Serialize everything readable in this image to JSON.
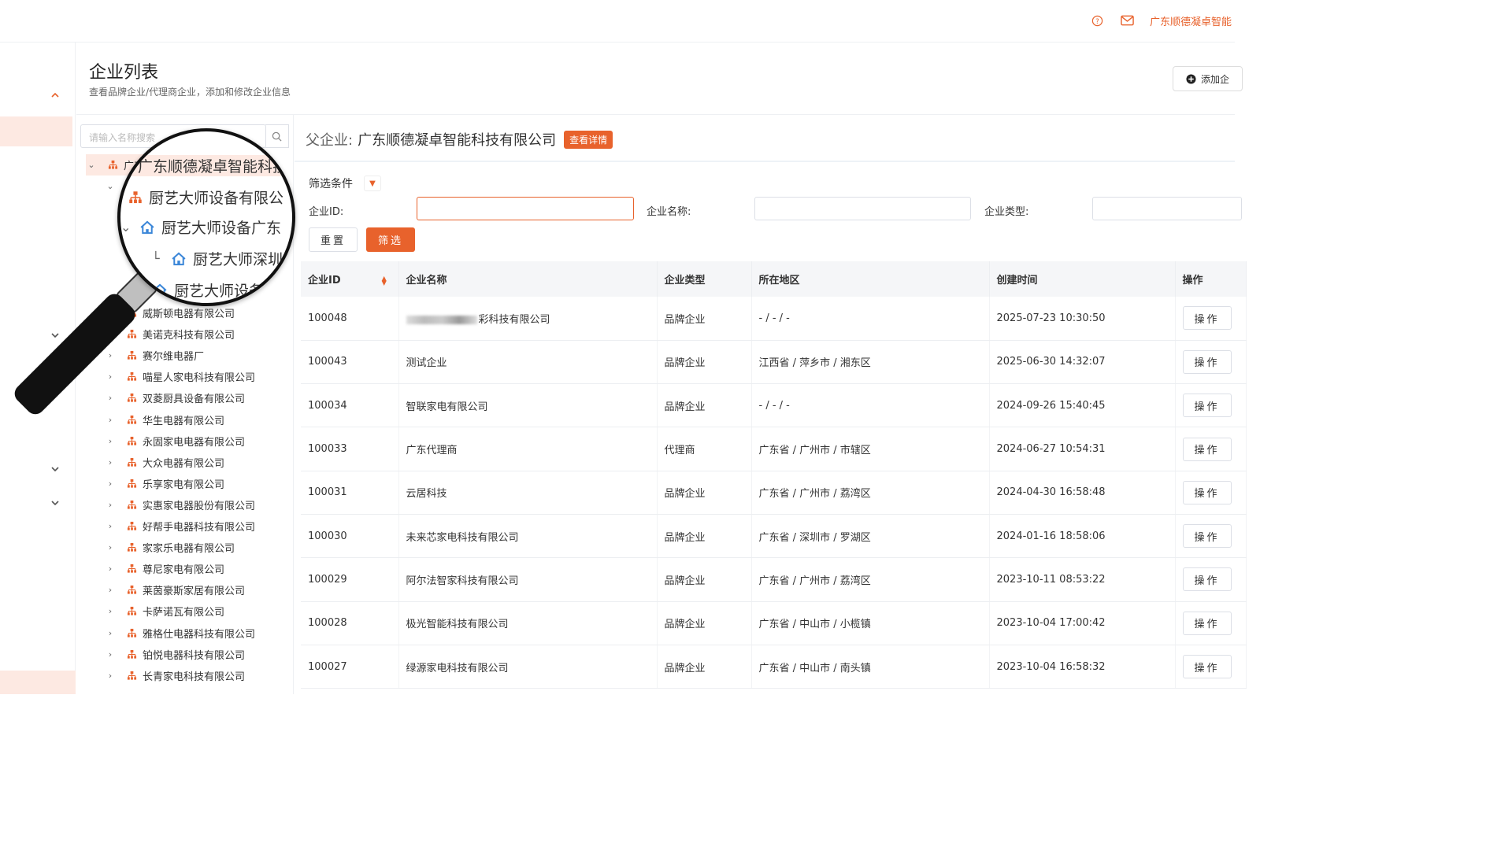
{
  "topbar": {
    "help_icon": "help-circle-icon",
    "mail_icon": "mail-icon",
    "company": "广东顺德凝卓智能"
  },
  "header": {
    "title": "企业列表",
    "subtitle": "查看品牌企业/代理商企业，添加和修改企业信息",
    "add_button": "添加企"
  },
  "sidebar": {
    "search_placeholder": "请输入名称搜索",
    "tree": [
      {
        "label": "广东顺德凝卓智能科技",
        "level": 0,
        "icon": "org-icon",
        "expanded": true
      },
      {
        "label": "厨艺大师设备有限公",
        "level": 1,
        "icon": "org-icon",
        "expanded": true
      },
      {
        "label": "厨艺大师设备广东",
        "level": 2,
        "icon": "home-icon",
        "expanded": true
      },
      {
        "label": "厨艺大师深圳",
        "level": 3,
        "icon": "home-icon"
      },
      {
        "label": "厨艺大师设备",
        "level": 2,
        "icon": "home-icon"
      },
      {
        "label": "威斯顿电器有限公司",
        "level": 1,
        "icon": "org-icon"
      },
      {
        "label": "美诺克科技有限公司",
        "level": 1,
        "icon": "org-icon"
      },
      {
        "label": "赛尔维电器厂",
        "level": 1,
        "icon": "org-icon"
      },
      {
        "label": "喵星人家电科技有限公司",
        "level": 1,
        "icon": "org-icon"
      },
      {
        "label": "双菱厨具设备有限公司",
        "level": 1,
        "icon": "org-icon"
      },
      {
        "label": "华生电器有限公司",
        "level": 1,
        "icon": "org-icon"
      },
      {
        "label": "永固家电电器有限公司",
        "level": 1,
        "icon": "org-icon"
      },
      {
        "label": "大众电器有限公司",
        "level": 1,
        "icon": "org-icon"
      },
      {
        "label": "乐享家电有限公司",
        "level": 1,
        "icon": "org-icon"
      },
      {
        "label": "实惠家电器股份有限公司",
        "level": 1,
        "icon": "org-icon"
      },
      {
        "label": "好帮手电器科技有限公司",
        "level": 1,
        "icon": "org-icon"
      },
      {
        "label": "家家乐电器有限公司",
        "level": 1,
        "icon": "org-icon"
      },
      {
        "label": "尊尼家电有限公司",
        "level": 1,
        "icon": "org-icon"
      },
      {
        "label": "莱茵豪斯家居有限公司",
        "level": 1,
        "icon": "org-icon"
      },
      {
        "label": "卡萨诺瓦有限公司",
        "level": 1,
        "icon": "org-icon"
      },
      {
        "label": "雅格仕电器科技有限公司",
        "level": 1,
        "icon": "org-icon"
      },
      {
        "label": "铂悦电器科技有限公司",
        "level": 1,
        "icon": "org-icon"
      },
      {
        "label": "长青家电科技有限公司",
        "level": 1,
        "icon": "org-icon"
      }
    ],
    "lens_rows": [
      "广东顺德凝卓智能科技",
      "厨艺大师设备有限公",
      "厨艺大师设备广东",
      "厨艺大师深圳",
      "厨艺大师设备"
    ]
  },
  "main": {
    "parent_label": "父企业:",
    "parent_name": "广东顺德凝卓智能科技有限公司",
    "detail_button": "查看详情",
    "filter_title": "筛选条件",
    "filters": {
      "id_label": "企业ID:",
      "name_label": "企业名称:",
      "type_label": "企业类型:",
      "id_value": "",
      "name_value": "",
      "type_value": ""
    },
    "reset_button": "重置",
    "filter_button": "筛选",
    "table": {
      "columns": [
        "企业ID",
        "企业名称",
        "企业类型",
        "所在地区",
        "创建时间",
        "操作"
      ],
      "rows": [
        {
          "id": "100048",
          "name": "彩科技有限公司",
          "name_redacted": true,
          "type": "品牌企业",
          "region": "- / - / -",
          "created": "2025-07-23 10:30:50",
          "op": "操作"
        },
        {
          "id": "100043",
          "name": "测试企业",
          "type": "品牌企业",
          "region": "江西省 / 萍乡市 / 湘东区",
          "created": "2025-06-30 14:32:07",
          "op": "操作"
        },
        {
          "id": "100034",
          "name": "智联家电有限公司",
          "type": "品牌企业",
          "region": "- / - / -",
          "created": "2024-09-26 15:40:45",
          "op": "操作"
        },
        {
          "id": "100033",
          "name": "广东代理商",
          "type": "代理商",
          "region": "广东省 / 广州市 / 市辖区",
          "created": "2024-06-27 10:54:31",
          "op": "操作"
        },
        {
          "id": "100031",
          "name": "云居科技",
          "type": "品牌企业",
          "region": "广东省 / 广州市 / 荔湾区",
          "created": "2024-04-30 16:58:48",
          "op": "操作"
        },
        {
          "id": "100030",
          "name": "未来芯家电科技有限公司",
          "type": "品牌企业",
          "region": "广东省 / 深圳市 / 罗湖区",
          "created": "2024-01-16 18:58:06",
          "op": "操作"
        },
        {
          "id": "100029",
          "name": "阿尔法智家科技有限公司",
          "type": "品牌企业",
          "region": "广东省 / 广州市 / 荔湾区",
          "created": "2023-10-11 08:53:22",
          "op": "操作"
        },
        {
          "id": "100028",
          "name": "极光智能科技有限公司",
          "type": "品牌企业",
          "region": "广东省 / 中山市 / 小榄镇",
          "created": "2023-10-04 17:00:42",
          "op": "操作"
        },
        {
          "id": "100027",
          "name": "绿源家电科技有限公司",
          "type": "品牌企业",
          "region": "广东省 / 中山市 / 南头镇",
          "created": "2023-10-04 16:58:32",
          "op": "操作"
        }
      ]
    }
  },
  "colors": {
    "accent": "#e8622c",
    "accent_light": "#fde9e2",
    "header_bg": "#f5f6f8"
  }
}
